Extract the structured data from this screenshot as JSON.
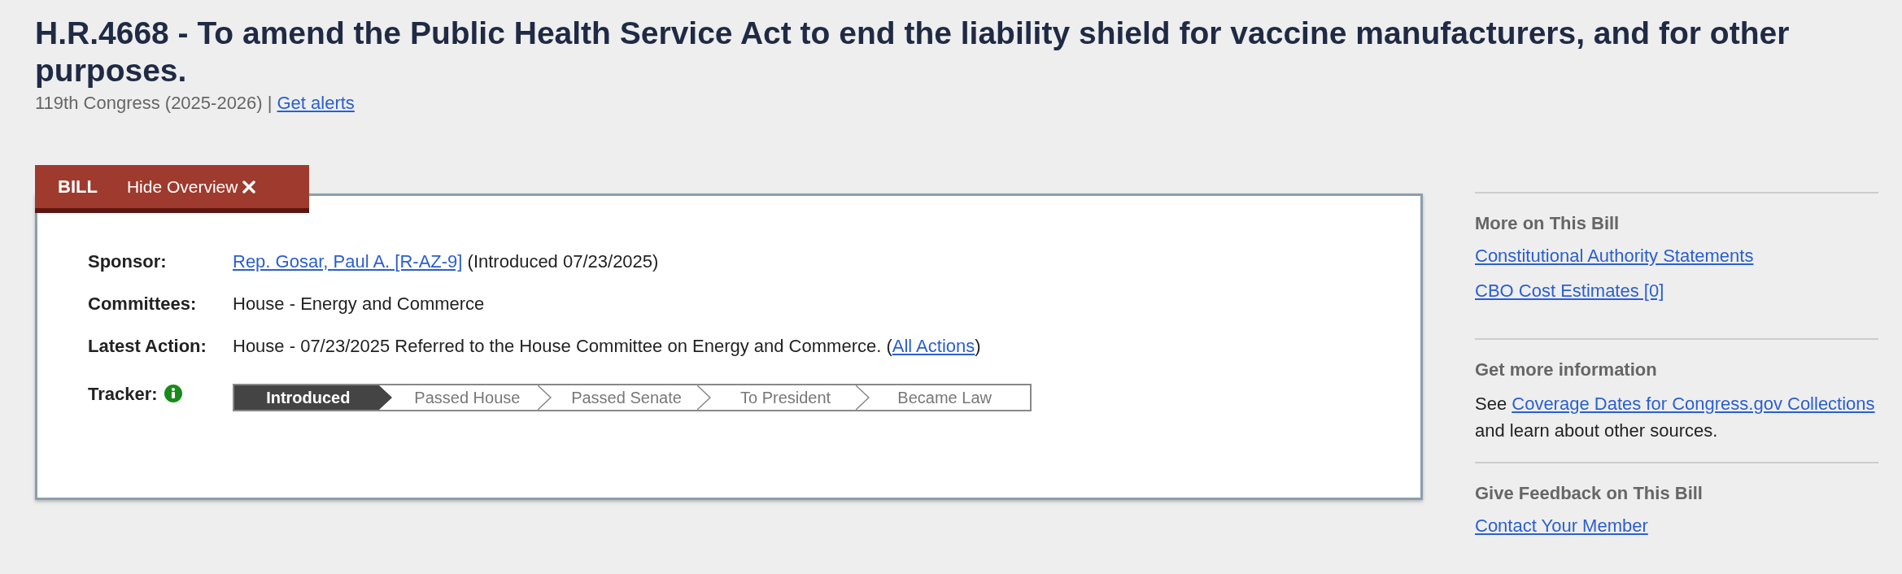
{
  "bill": {
    "title": "H.R.4668 - To amend the Public Health Service Act to end the liability shield for vaccine manufacturers, and for other purposes.",
    "congress": "119th Congress (2025-2026) |",
    "alerts_link": "Get alerts"
  },
  "overview_tabs": {
    "label": "BILL",
    "hide_button": "Hide Overview"
  },
  "overview": {
    "rows": [
      {
        "label": "Sponsor:",
        "kind": "link_first",
        "link": "Rep. Gosar, Paul A. [R-AZ-9]",
        "text": " (Introduced 07/23/2025)"
      },
      {
        "label": "Committees:",
        "kind": "plain",
        "text": "House - Energy and Commerce"
      },
      {
        "label": "Latest Action:",
        "kind": "link_last",
        "text": "House - 07/23/2025 Referred to the House Committee on Energy and Commerce.  (",
        "link": "All Actions",
        "after": ")"
      }
    ],
    "tracker": {
      "label": "Tracker:",
      "stages": [
        {
          "label": "Introduced",
          "selected": true
        },
        {
          "label": "Passed House",
          "selected": false
        },
        {
          "label": "Passed Senate",
          "selected": false
        },
        {
          "label": "To President",
          "selected": false
        },
        {
          "label": "Became Law",
          "selected": false
        }
      ]
    }
  },
  "sidebar": {
    "sections": [
      {
        "heading": "More on This Bill",
        "kind": "links",
        "links": [
          "Constitutional Authority Statements",
          "CBO Cost Estimates [0]"
        ]
      },
      {
        "heading": "Get more information",
        "kind": "sentence",
        "before": "See ",
        "link": "Coverage Dates for Congress.gov Collections",
        "after": " and learn about other sources."
      },
      {
        "heading": "Give Feedback on This Bill",
        "kind": "links",
        "links": [
          "Contact Your Member"
        ]
      }
    ]
  }
}
